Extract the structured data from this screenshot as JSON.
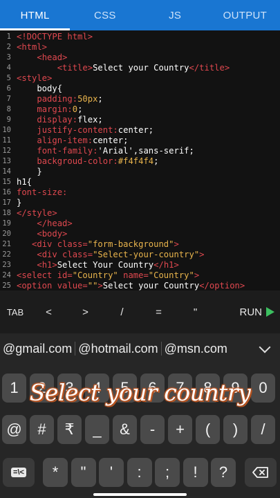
{
  "tabs": [
    {
      "label": "HTML",
      "active": true
    },
    {
      "label": "CSS",
      "active": false
    },
    {
      "label": "JS",
      "active": false
    },
    {
      "label": "OUTPUT",
      "active": false
    }
  ],
  "colors": {
    "tabbar": "#1976d2",
    "editor_bg": "#121212",
    "tag": "#e0484f",
    "string": "#e9b44c",
    "text": "#ffffff",
    "run_icon": "#3cc060"
  },
  "code_lines": [
    {
      "n": "1",
      "segs": [
        [
          "t",
          "<!DOCTYPE html>"
        ]
      ]
    },
    {
      "n": "2",
      "segs": [
        [
          "t",
          "<html>"
        ]
      ]
    },
    {
      "n": "3",
      "segs": [
        [
          "x",
          "    "
        ],
        [
          "t",
          "<head>"
        ]
      ]
    },
    {
      "n": "4",
      "segs": [
        [
          "x",
          "        "
        ],
        [
          "t",
          "<title>"
        ],
        [
          "x",
          "Select your Country"
        ],
        [
          "t",
          "</title>"
        ]
      ]
    },
    {
      "n": "5",
      "segs": [
        [
          "t",
          "<style>"
        ]
      ]
    },
    {
      "n": "6",
      "segs": [
        [
          "x",
          "    body{"
        ]
      ]
    },
    {
      "n": "7",
      "segs": [
        [
          "x",
          "    "
        ],
        [
          "t",
          "padding:"
        ],
        [
          "s",
          "50px"
        ],
        [
          "x",
          ";"
        ]
      ]
    },
    {
      "n": "8",
      "segs": [
        [
          "x",
          "    "
        ],
        [
          "t",
          "margin:"
        ],
        [
          "s",
          "0"
        ],
        [
          "x",
          ";"
        ]
      ]
    },
    {
      "n": "9",
      "segs": [
        [
          "x",
          "    "
        ],
        [
          "t",
          "display:"
        ],
        [
          "x",
          "flex;"
        ]
      ]
    },
    {
      "n": "10",
      "segs": [
        [
          "x",
          "    "
        ],
        [
          "t",
          "justify-content:"
        ],
        [
          "x",
          "center;"
        ]
      ]
    },
    {
      "n": "11",
      "segs": [
        [
          "x",
          "    "
        ],
        [
          "t",
          "align-item:"
        ],
        [
          "x",
          "center;"
        ]
      ]
    },
    {
      "n": "12",
      "segs": [
        [
          "x",
          "    "
        ],
        [
          "t",
          "font-family:"
        ],
        [
          "x",
          "'Arial',sans-serif;"
        ]
      ]
    },
    {
      "n": "13",
      "segs": [
        [
          "x",
          "    "
        ],
        [
          "t",
          "backgroud-color:"
        ],
        [
          "s",
          "#f4f4f4"
        ],
        [
          "x",
          ";"
        ]
      ]
    },
    {
      "n": "14",
      "segs": [
        [
          "x",
          "    }"
        ]
      ]
    },
    {
      "n": "15",
      "segs": [
        [
          "x",
          "h1{"
        ]
      ]
    },
    {
      "n": "16",
      "segs": [
        [
          "t",
          "font-size:"
        ]
      ]
    },
    {
      "n": "17",
      "segs": [
        [
          "x",
          "}"
        ]
      ]
    },
    {
      "n": "18",
      "segs": [
        [
          "t",
          "</style>"
        ]
      ]
    },
    {
      "n": "19",
      "segs": [
        [
          "x",
          "    "
        ],
        [
          "t",
          "</head>"
        ]
      ]
    },
    {
      "n": "20",
      "segs": [
        [
          "x",
          "    "
        ],
        [
          "t",
          "<body>"
        ]
      ]
    },
    {
      "n": "21",
      "segs": [
        [
          "x",
          "   "
        ],
        [
          "t",
          "<div class="
        ],
        [
          "s",
          "\"form-background\""
        ],
        [
          "t",
          ">"
        ]
      ]
    },
    {
      "n": "22",
      "segs": [
        [
          "x",
          "    "
        ],
        [
          "t",
          "<div class="
        ],
        [
          "s",
          "\"Select-your-country\""
        ],
        [
          "t",
          ">"
        ]
      ]
    },
    {
      "n": "23",
      "segs": [
        [
          "x",
          "    "
        ],
        [
          "t",
          "<h1>"
        ],
        [
          "x",
          "Select Your Country"
        ],
        [
          "t",
          "</h1>"
        ]
      ]
    },
    {
      "n": "24",
      "segs": [
        [
          "t",
          "<select id="
        ],
        [
          "s",
          "\"Country\""
        ],
        [
          "t",
          " name="
        ],
        [
          "s",
          "\"Country\""
        ],
        [
          "t",
          ">"
        ]
      ]
    },
    {
      "n": "25",
      "segs": [
        [
          "t",
          "<option value="
        ],
        [
          "s",
          "\"\""
        ],
        [
          "t",
          ">"
        ],
        [
          "x",
          "Select your Country"
        ],
        [
          "t",
          "</option>"
        ]
      ]
    }
  ],
  "symbols": [
    "TAB",
    "<",
    ">",
    "/",
    "=",
    "\""
  ],
  "run_label": "RUN",
  "suggestions": [
    "@gmail.com",
    "@hotmail.com",
    "@msn.com"
  ],
  "keyboard": {
    "row1": [
      "1",
      "2",
      "3",
      "4",
      "5",
      "6",
      "7",
      "8",
      "9",
      "0"
    ],
    "row2": [
      "@",
      "#",
      "₹",
      "_",
      "&",
      "-",
      "+",
      "(",
      ")",
      "/"
    ],
    "row3_left": "=\\<",
    "row3": [
      "*",
      "\"",
      "'",
      ":",
      ";",
      "!",
      "?"
    ],
    "backspace_icon": "backspace-icon"
  },
  "caption": "Select your country"
}
